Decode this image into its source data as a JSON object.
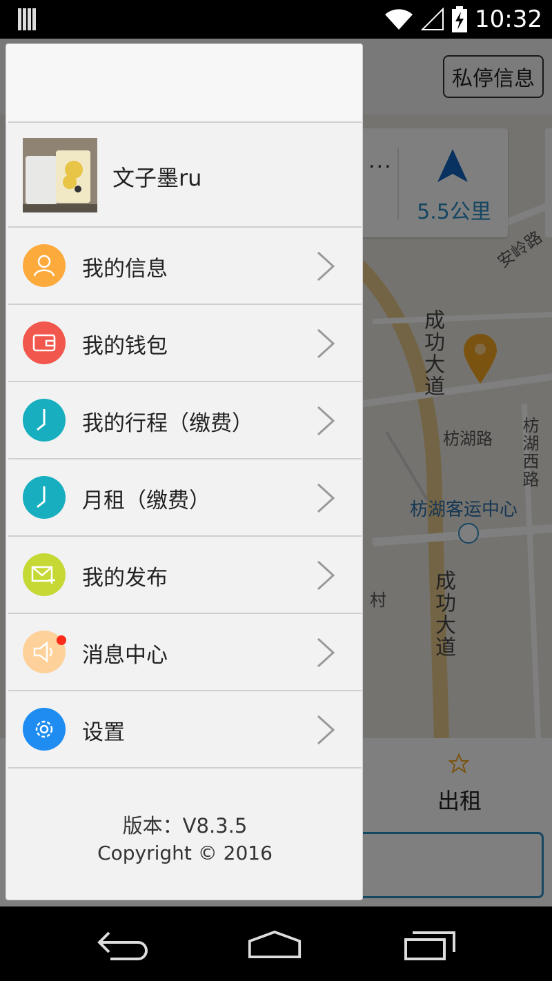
{
  "status_bar": {
    "time": "10:32",
    "icons": [
      "signal-bars-icon",
      "wifi-icon",
      "cell-signal-icon",
      "battery-charging-icon"
    ]
  },
  "background_app": {
    "top_button": "私停信息",
    "nav_card": {
      "dots": "...",
      "distance": "5.5公里",
      "icon": "navigation-arrow-icon"
    },
    "map_labels": [
      "安岭路",
      "成功大道",
      "枋湖路",
      "枋湖西路",
      "枋湖客运中心",
      "村",
      "成功大道"
    ],
    "bottom": {
      "star_icon": "star-icon",
      "rent_label": "出租"
    }
  },
  "drawer": {
    "user": {
      "name": "文子墨ru",
      "avatar": "avatar-photo"
    },
    "menu": [
      {
        "label": "我的信息",
        "icon": "person-icon",
        "color": "#FDAA3C"
      },
      {
        "label": "我的钱包",
        "icon": "wallet-icon",
        "color": "#F2574E"
      },
      {
        "label": "我的行程（缴费）",
        "icon": "clock-icon",
        "color": "#17AFBF"
      },
      {
        "label": "月租（缴费）",
        "icon": "clock-icon",
        "color": "#17AFBF"
      },
      {
        "label": "我的发布",
        "icon": "mail-add-icon",
        "color": "#C6D834"
      },
      {
        "label": "消息中心",
        "icon": "speaker-icon",
        "color": "#FDD199",
        "badge": true
      },
      {
        "label": "设置",
        "icon": "gear-icon",
        "color": "#1E8CF0"
      }
    ],
    "version": "版本：V8.3.5",
    "copyright": "Copyright © 2016"
  },
  "system_nav": {
    "back": "back-icon",
    "home": "home-icon",
    "recent": "recent-apps-icon"
  }
}
